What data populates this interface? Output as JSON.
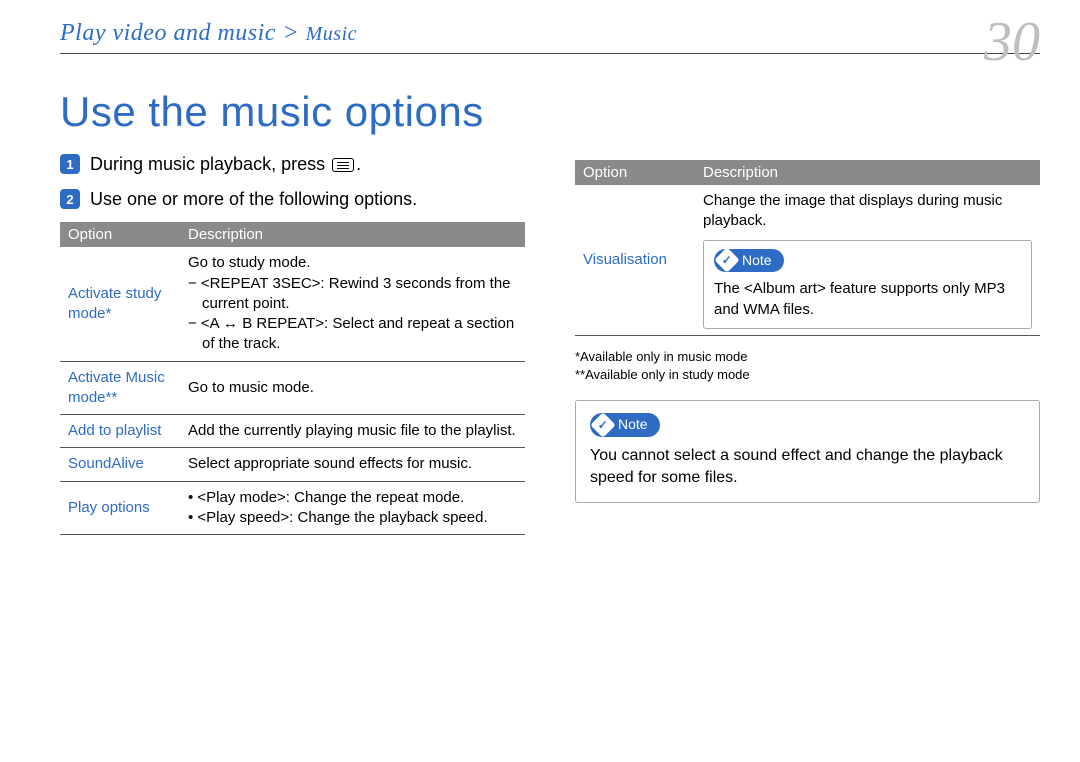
{
  "header": {
    "breadcrumb_main": "Play video and music >",
    "breadcrumb_sub": "Music",
    "page_number": "30"
  },
  "title": "Use the music options",
  "steps": [
    {
      "num": "1",
      "text_pre": "During music playback, press ",
      "text_post": "."
    },
    {
      "num": "2",
      "text": "Use one or more of the following options."
    }
  ],
  "table_headers": {
    "option": "Option",
    "description": "Description"
  },
  "left_table": [
    {
      "option": "Activate study mode*",
      "lines": [
        "Go to study mode.",
        "− <REPEAT 3SEC>: Rewind 3 seconds from  the current point.",
        "− <A ↔ B REPEAT>: Select and repeat a section of the track."
      ]
    },
    {
      "option": "Activate Music mode**",
      "lines": [
        "Go to music mode."
      ]
    },
    {
      "option": "Add to playlist",
      "lines": [
        "Add the currently playing music file to the playlist."
      ]
    },
    {
      "option": "SoundAlive",
      "lines": [
        "Select appropriate sound effects for music."
      ]
    },
    {
      "option": "Play options",
      "lines": [
        "• <Play mode>: Change the repeat mode.",
        "• <Play speed>: Change the playback speed."
      ]
    }
  ],
  "right_table": [
    {
      "option": "Visualisation",
      "plain": "Change the image that displays during music playback.",
      "note_label": "Note",
      "note_text": "The <Album art> feature supports only MP3 and WMA files."
    }
  ],
  "footnotes": [
    "*Available only in music mode",
    "**Available only in study mode"
  ],
  "outer_note": {
    "label": "Note",
    "text": "You cannot select a sound effect and change the playback speed for some files."
  }
}
